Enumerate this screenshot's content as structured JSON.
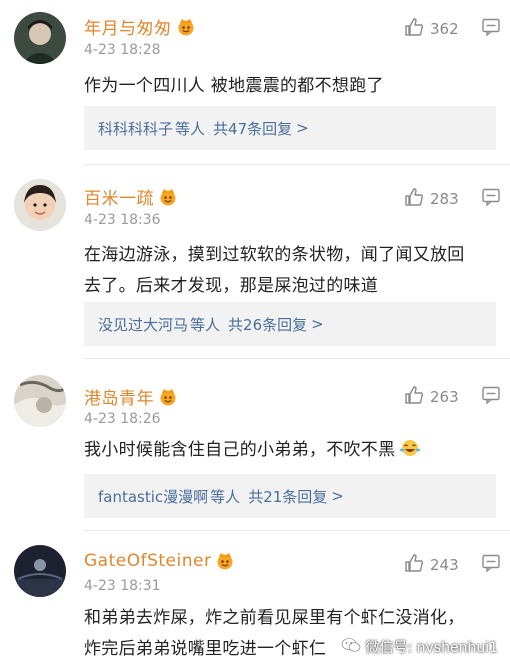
{
  "comments": [
    {
      "name": "年月与匆匆",
      "time": "4-23 18:28",
      "likes": "362",
      "text": "作为一个四川人 被地震震的都不想跑了",
      "reply_users": "科科科科子",
      "reply_others": "等人",
      "reply_total": "共47条回复",
      "reply_chevron": ">"
    },
    {
      "name": "百米一疏",
      "time": "4-23 18:36",
      "likes": "283",
      "text_line1": "在海边游泳，摸到过软软的条状物，闻了闻又放回",
      "text_line2": "去了。后来才发现，那是屎泡过的味道",
      "reply_users": "没见过大河马",
      "reply_others": "等人",
      "reply_total": "共26条回复",
      "reply_chevron": ">"
    },
    {
      "name": "港岛青年",
      "time": "4-23 18:26",
      "likes": "263",
      "text": "我小时候能含住自己的小弟弟，不吹不黑",
      "reply_users": "fantastic漫漫啊",
      "reply_others": "等人",
      "reply_total": "共21条回复",
      "reply_chevron": ">"
    },
    {
      "name": "GateOfSteiner",
      "time": "4-23 18:31",
      "likes": "243",
      "text_line1": "和弟弟去炸屎，炸之前看见屎里有个虾仁没消化，",
      "text_line2": "炸完后弟弟说嘴里吃进一个虾仁"
    }
  ],
  "watermark": "微信号: nvshenhui1",
  "icons": {
    "like": "thumbs-up-icon",
    "reply": "comment-icon",
    "vip": "vip-crown-icon",
    "emoji": "laughing-emoji-icon",
    "watermark": "wechat-icon"
  },
  "colors": {
    "name": "#e0872c",
    "reply_link": "#4a6f9c",
    "time": "#9a9a9a",
    "reply_bg": "#f2f2f2"
  }
}
